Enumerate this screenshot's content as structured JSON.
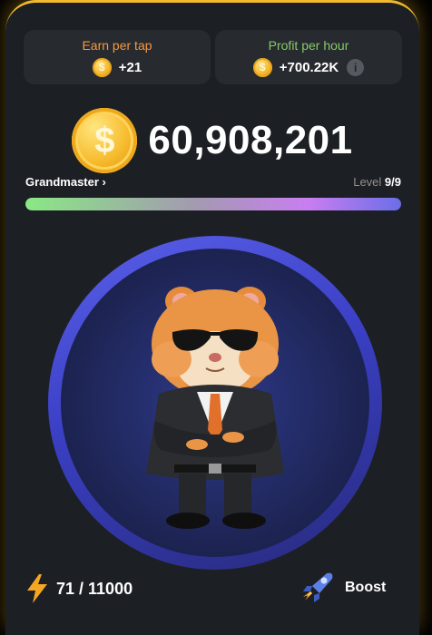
{
  "stats": {
    "earn_per_tap": {
      "title": "Earn per tap",
      "value": "+21"
    },
    "profit_per_hour": {
      "title": "Profit per hour",
      "value": "+700.22K"
    }
  },
  "balance": {
    "value": "60,908,201"
  },
  "league": {
    "name": "Grandmaster",
    "chevron": "›",
    "level_label": "Level",
    "level_value": "9/9",
    "progress": 1.0
  },
  "energy": {
    "value": "71 / 11000"
  },
  "boost": {
    "label": "Boost"
  },
  "icons": {
    "coin": "coin-icon",
    "info": "info-icon",
    "lightning": "lightning-icon",
    "rocket": "rocket-icon"
  },
  "colors": {
    "accent": "#f3ba2f",
    "earn_title": "#f79841",
    "profit_title": "#84cb69",
    "card_bg": "#272a2f",
    "panel_bg": "#1c1f24"
  }
}
